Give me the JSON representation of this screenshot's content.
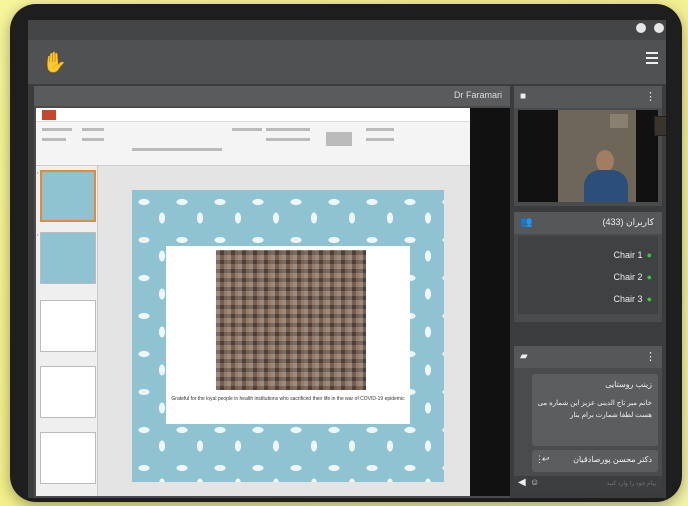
{
  "meeting": {
    "presenter_name": "Dr Faramari",
    "hand_icon": "hand-icon",
    "menu_icon": "menu-icon"
  },
  "users": {
    "title": "کاربران (433)",
    "items": [
      {
        "label": "Chair 1"
      },
      {
        "label": "Chair 2"
      },
      {
        "label": "Chair 3"
      }
    ]
  },
  "chat": {
    "sender1": "زینب روستایی",
    "message1": "خانم میر تاج الدینی عزیز این شماره می هست لطفا شمارت برام بنار",
    "sender2": "دکتر محسن پورصادقیان",
    "input_placeholder": "پیام خود را وارد کنید"
  },
  "slide": {
    "caption": "Grateful for the loyal people in health institutions who sacrificed their life in the war of COVID-19 epidemic"
  },
  "colors": {
    "slide_bg": "#8fc3d2",
    "accent_ok": "#3fbf4f",
    "app_bg": "#3b3c3e"
  }
}
